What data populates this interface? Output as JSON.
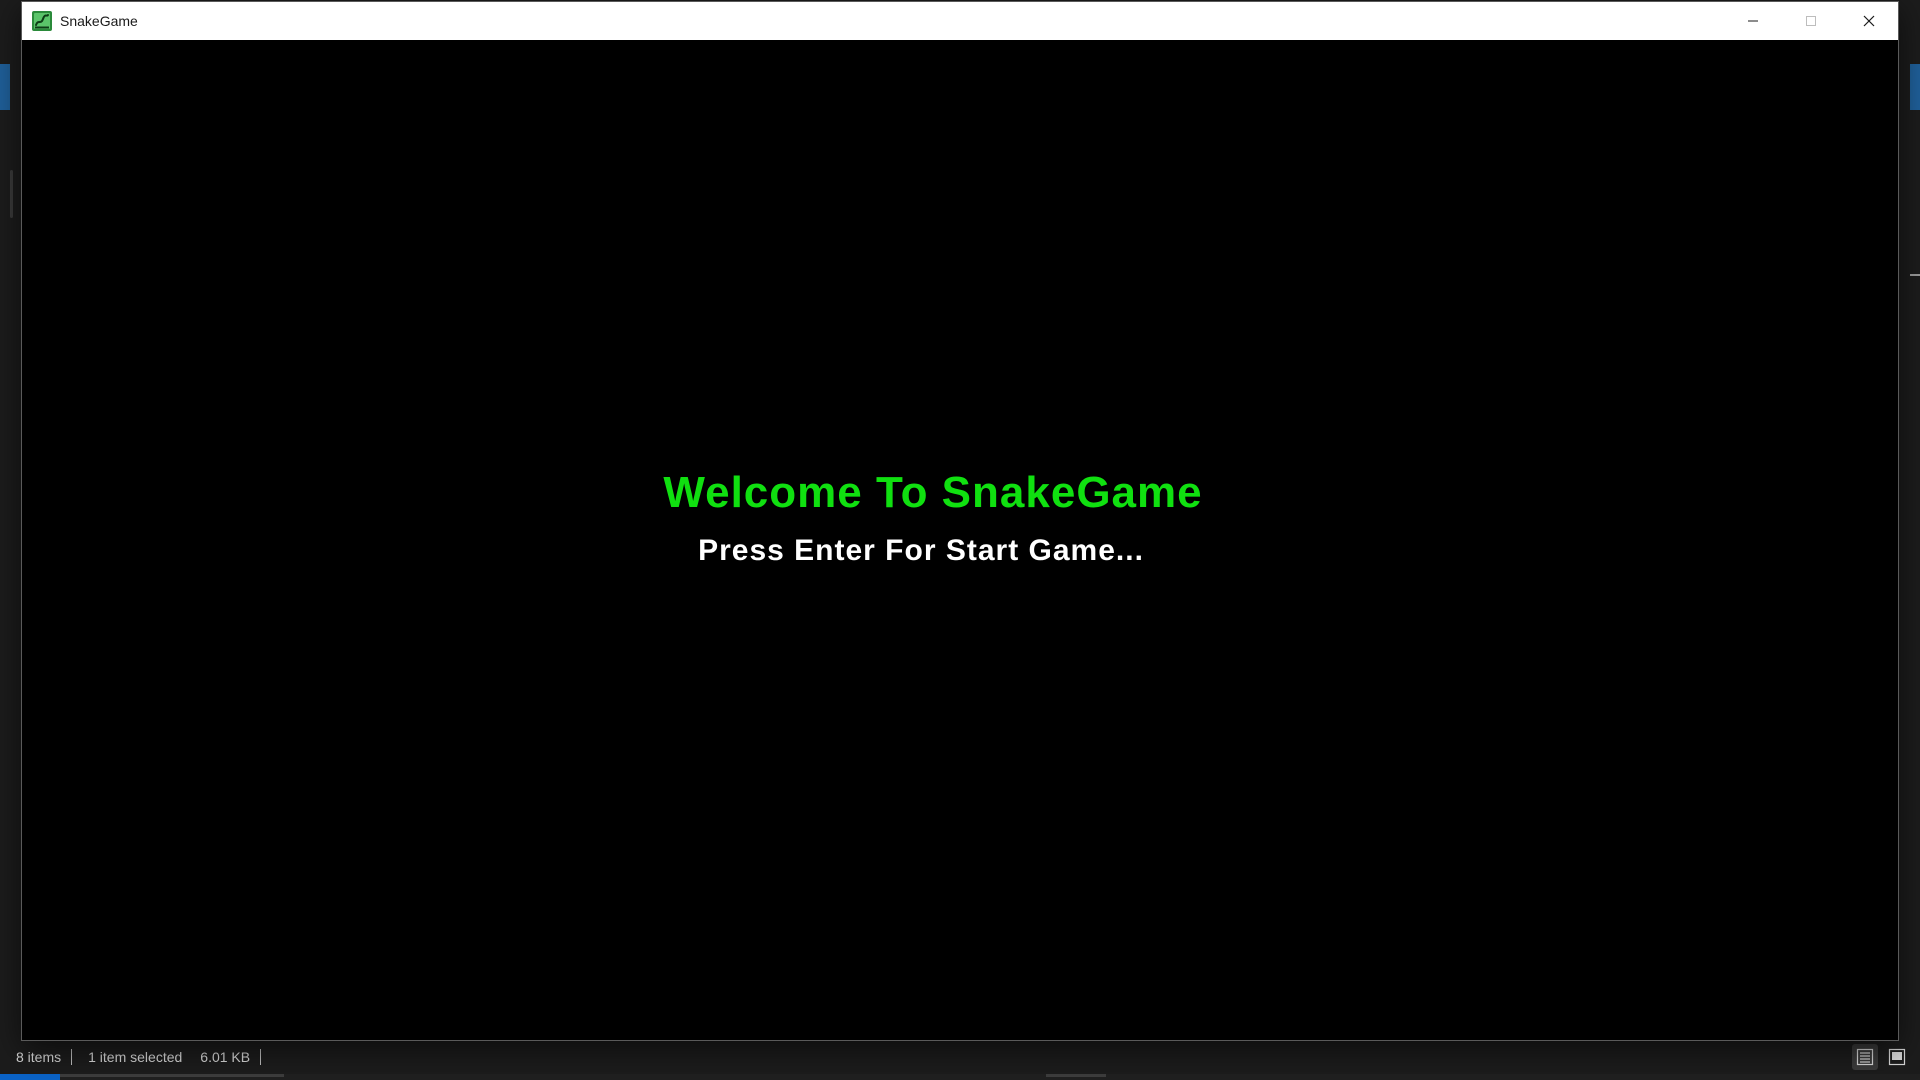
{
  "window": {
    "title": "SnakeGame",
    "icon": "snake-app-icon",
    "controls": [
      "minimize-icon",
      "maximize-icon",
      "close-icon"
    ]
  },
  "game": {
    "welcome_text": "Welcome To SnakeGame",
    "prompt_text": "Press Enter For Start Game...",
    "welcome_color": "#10e010",
    "prompt_color": "#ffffff",
    "background_color": "#000000"
  },
  "statusbar": {
    "items_count": "8 items",
    "selection": "1 item selected",
    "size": "6.01 KB"
  },
  "colors": {
    "accent": "#0b63c7"
  }
}
